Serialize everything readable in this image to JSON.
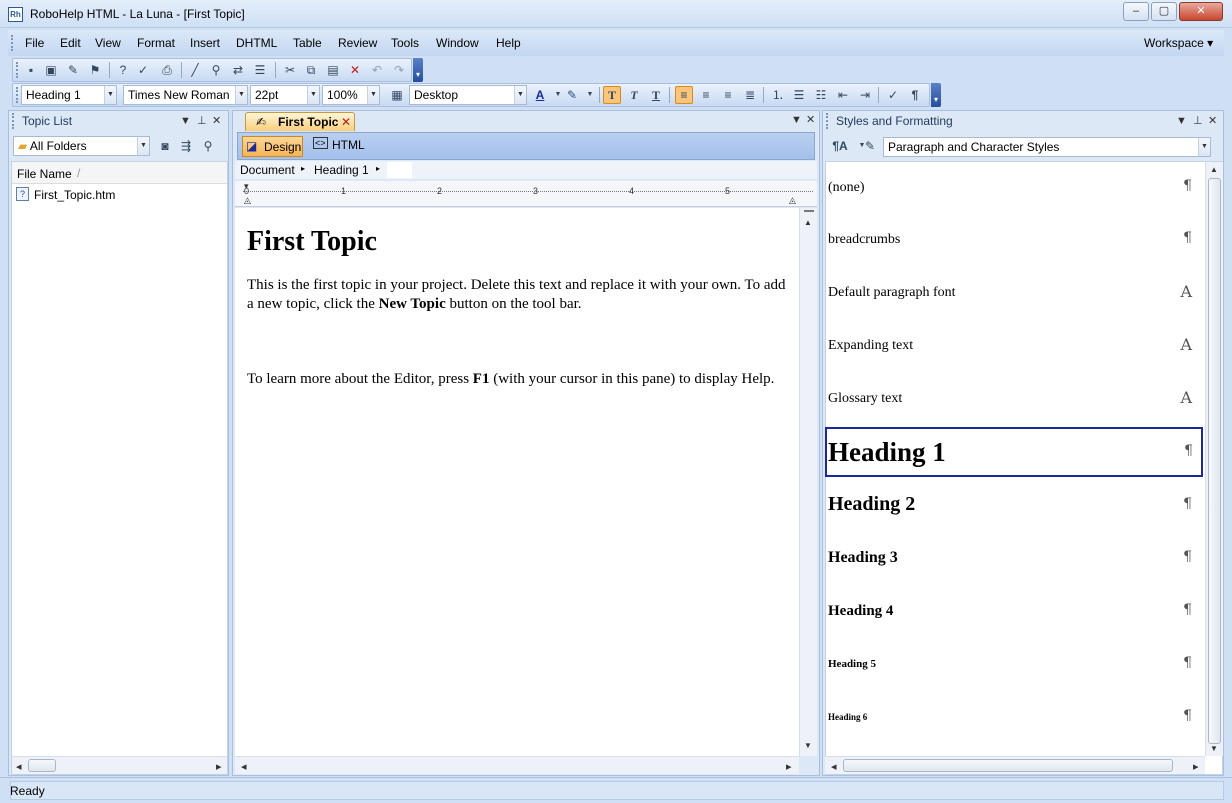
{
  "window": {
    "title": "RoboHelp HTML - La Luna - [First Topic]",
    "app_icon_text": "Rh",
    "controls": {
      "minimize": "–",
      "maximize": "▢",
      "close": "✕"
    }
  },
  "menu": {
    "items": [
      "File",
      "Edit",
      "View",
      "Format",
      "Insert",
      "DHTML",
      "Table",
      "Review",
      "Tools",
      "Window",
      "Help"
    ],
    "workspace": "Workspace ▾"
  },
  "format_toolbar": {
    "style": "Heading 1",
    "font": "Times New Roman",
    "size": "22pt",
    "zoom": "100%",
    "view": "Desktop",
    "bold_label": "T",
    "italic_label": "T",
    "underline_label": "T"
  },
  "topic_list": {
    "title": "Topic List",
    "folder": "All Folders",
    "column_header": "File Name",
    "sort_mark": "/",
    "files": [
      "First_Topic.htm"
    ]
  },
  "editor": {
    "tab_label": "First Topic",
    "mode_design": "Design",
    "mode_html": "HTML",
    "breadcrumb": [
      "Document",
      "Heading 1"
    ],
    "ruler_numbers": [
      "0",
      "1",
      "2",
      "3",
      "4",
      "5"
    ],
    "heading": "First Topic",
    "para1_before": "This is the first topic in your project. Delete this text and replace it with your own. To add a new topic, click the ",
    "para1_bold": "New Topic",
    "para1_after": " button on the tool bar.",
    "para2_before": "To learn more about the Editor, press ",
    "para2_bold": "F1",
    "para2_after": " (with your cursor in this pane) to display Help."
  },
  "styles_pane": {
    "title": "Styles and Formatting",
    "filter": "Paragraph and Character Styles",
    "styles": [
      {
        "name": "(none)",
        "marker": "¶"
      },
      {
        "name": "breadcrumbs",
        "marker": "¶"
      },
      {
        "name": "Default paragraph font",
        "marker": "A"
      },
      {
        "name": "Expanding text",
        "marker": "A"
      },
      {
        "name": "Glossary text",
        "marker": "A"
      },
      {
        "name": "Heading 1",
        "marker": "¶"
      },
      {
        "name": "Heading 2",
        "marker": "¶"
      },
      {
        "name": "Heading 3",
        "marker": "¶"
      },
      {
        "name": "Heading 4",
        "marker": "¶"
      },
      {
        "name": "Heading 5",
        "marker": "¶"
      },
      {
        "name": "Heading 6",
        "marker": "¶"
      }
    ],
    "selected": "Heading 1"
  },
  "status": {
    "text": "Ready"
  },
  "colors": {
    "accent": "#f9c57d",
    "selection_border": "#1a2a9a",
    "chrome": "#cfe0f5"
  }
}
